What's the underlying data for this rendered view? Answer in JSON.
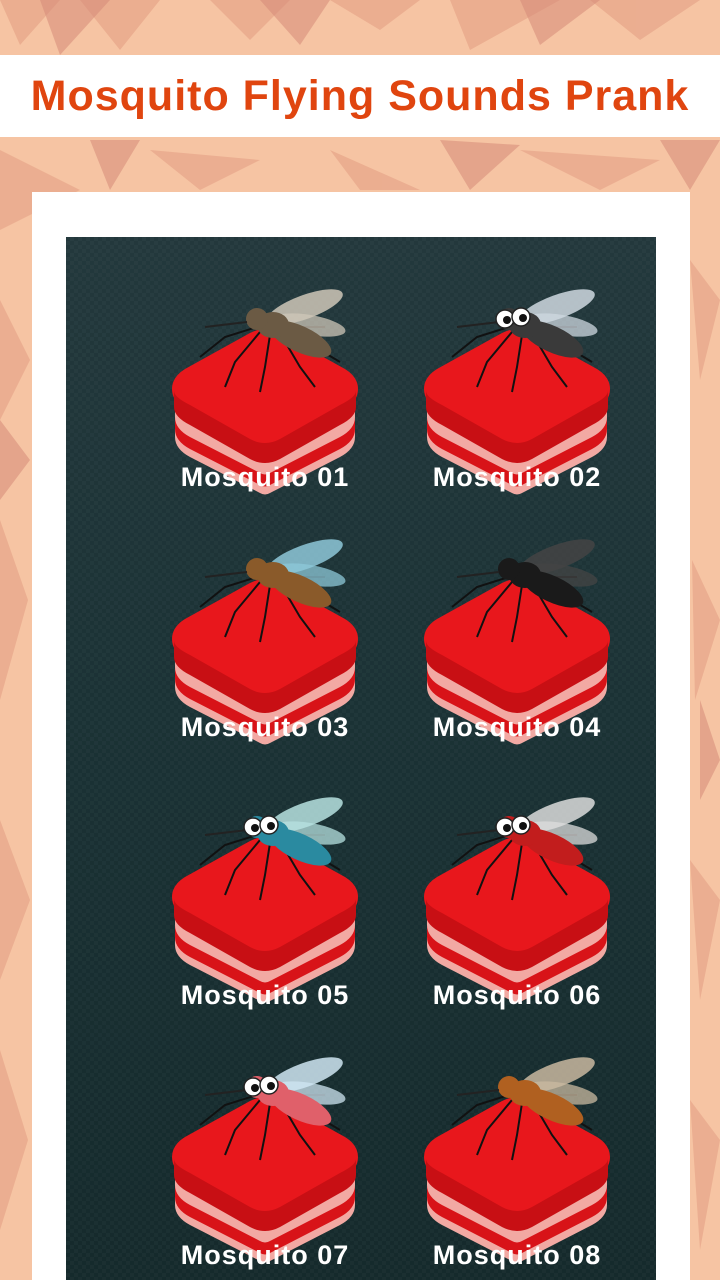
{
  "header": {
    "title": "Mosquito Flying Sounds Prank"
  },
  "colors": {
    "accent": "#e0450f",
    "pad_top": "#e8171c",
    "pad_stripe": "#f2a9a3",
    "panel": "#1b3235"
  },
  "sounds": [
    {
      "label": "Mosquito 01",
      "icon": "mosquito-realistic-icon"
    },
    {
      "label": "Mosquito 02",
      "icon": "mosquito-cartoon-grey-icon"
    },
    {
      "label": "Mosquito 03",
      "icon": "mosquito-brown-icon"
    },
    {
      "label": "Mosquito 04",
      "icon": "mosquito-tiger-icon"
    },
    {
      "label": "Mosquito 05",
      "icon": "mosquito-blue-icon"
    },
    {
      "label": "Mosquito 06",
      "icon": "mosquito-red-cartoon-icon"
    },
    {
      "label": "Mosquito 07",
      "icon": "mosquito-pink-cartoon-icon"
    },
    {
      "label": "Mosquito 08",
      "icon": "mosquito-orange-icon"
    }
  ]
}
